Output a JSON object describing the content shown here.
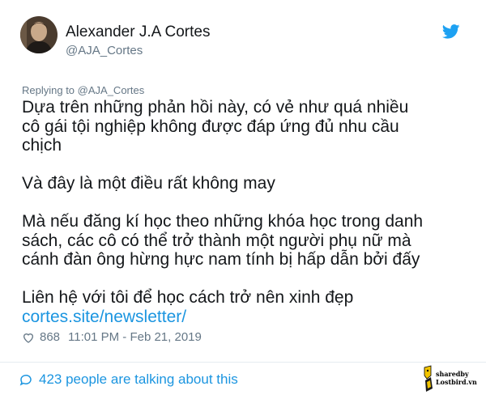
{
  "tweet": {
    "display_name": "Alexander J.A Cortes",
    "handle": "@AJA_Cortes",
    "replying_prefix": "Replying to ",
    "replying_to": "@AJA_Cortes",
    "paragraphs": [
      [
        "Dựa trên những phản hồi này, có vẻ như quá nhiều",
        "cô gái tội nghiệp không được đáp ứng đủ nhu cầu",
        "chịch"
      ],
      [
        "Và đây là một điều rất không may"
      ],
      [
        "Mà nếu đăng kí học theo những khóa học trong danh",
        "sách, các cô có thể trở thành một người phụ nữ mà",
        "cánh đàn ông hừng hực nam tính bị hấp dẫn bởi đấy"
      ],
      [
        "Liên hệ với tôi để học cách trở nên xinh đẹp"
      ]
    ],
    "link": "cortes.site/newsletter/",
    "likes": "868",
    "timestamp": "11:01 PM - Feb 21, 2019",
    "talking": "423 people are talking about this"
  },
  "watermark": {
    "line1": "sharedby",
    "line2": "Lostbird.vn"
  },
  "icons": {
    "twitter": "twitter-bird-icon",
    "like": "heart-icon",
    "comments": "speech-bubble-icon"
  },
  "colors": {
    "link": "#1b95e0",
    "muted": "#657786",
    "text": "#14171a",
    "divider": "#e6ecf0"
  }
}
